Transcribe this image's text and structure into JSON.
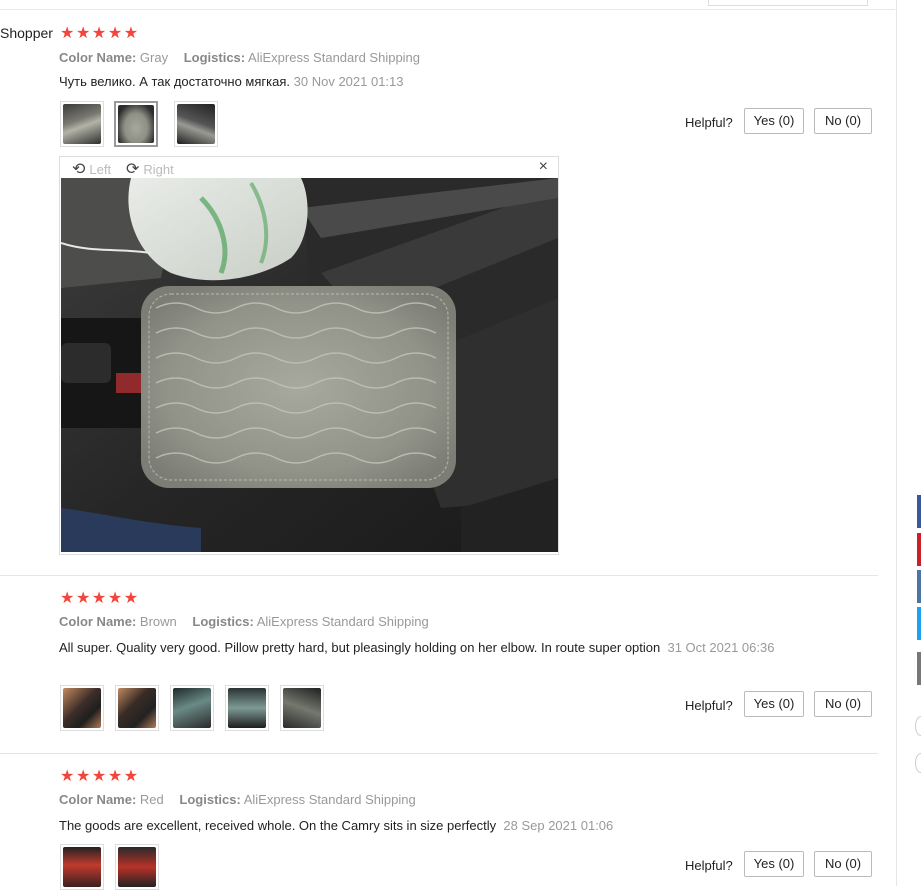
{
  "reviews": [
    {
      "username": "Shopper",
      "stars": "★★★★★",
      "color_label": "Color Name:",
      "color_value": "Gray",
      "logistics_label": "Logistics:",
      "logistics_value": "AliExpress Standard Shipping",
      "text": "Чуть велико. А так достаточно мягкая.",
      "date": "30 Nov 2021 01:13",
      "thumbnail_count": 3
    },
    {
      "stars": "★★★★★",
      "color_label": "Color Name:",
      "color_value": "Brown",
      "logistics_label": "Logistics:",
      "logistics_value": "AliExpress Standard Shipping",
      "text": "All super. Quality very good. Pillow pretty hard, but pleasingly holding on her elbow. In route super option",
      "date": "31 Oct 2021 06:36",
      "thumbnail_count": 5
    },
    {
      "stars": "★★★★★",
      "color_label": "Color Name:",
      "color_value": "Red",
      "logistics_label": "Logistics:",
      "logistics_value": "AliExpress Standard Shipping",
      "text": "The goods are excellent, received whole. On the Camry sits in size perfectly",
      "date": "28 Sep 2021 01:06",
      "thumbnail_count": 2
    }
  ],
  "helpful": {
    "label": "Helpful?",
    "yes": "Yes (0)",
    "no": "No (0)"
  },
  "viewer": {
    "rotate_left": "Left",
    "rotate_right": "Right",
    "close_icon": "×",
    "rotate_left_icon": "⟲",
    "rotate_right_icon": "⟳"
  },
  "colors": {
    "star": "#f2463b",
    "muted_text": "#999999",
    "border": "#dddddd",
    "social_facebook": "#3b5998",
    "social_pinterest": "#cb2027",
    "social_vk": "#4c75a3",
    "social_twitter": "#1da1f2",
    "social_other": "#777777"
  }
}
